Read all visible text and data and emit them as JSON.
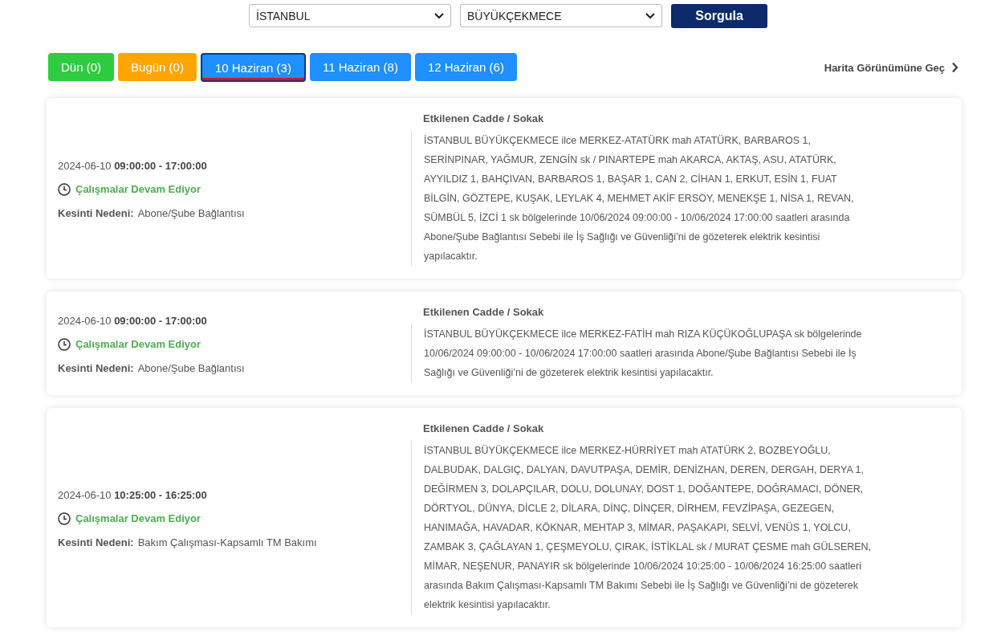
{
  "filters": {
    "city": "İSTANBUL",
    "district": "BÜYÜKÇEKMECE",
    "submit": "Sorgula"
  },
  "tabs": [
    {
      "label": "Dün (0)",
      "color": "#2ecc40",
      "selected": false
    },
    {
      "label": "Bugün (0)",
      "color": "#ffa500",
      "selected": false
    },
    {
      "label": "10 Haziran (3)",
      "color": "#1e90ff",
      "selected": true
    },
    {
      "label": "11 Haziran (8)",
      "color": "#1e90ff",
      "selected": false
    },
    {
      "label": "12 Haziran (6)",
      "color": "#1e90ff",
      "selected": false
    }
  ],
  "map_link": "Harita Görünümüne Geç",
  "outages": [
    {
      "datetime": "2024-06-10 **09:00:00 - 17:00:00**",
      "status": "Çalışmalar Devam Ediyor",
      "reason_label": "Kesinti Nedeni:",
      "reason": "Abone/Şube Bağlantısı",
      "streets_title": "Etkilenen Cadde / Sokak",
      "description": "İSTANBUL BÜYÜKÇEKMECE ilce MERKEZ-ATATÜRK mah ATATÜRK, BARBAROS 1, SERİNPINAR, YAĞMUR, ZENGİN sk / PINARTEPE mah AKARCA, AKTAŞ, ASU, ATATÜRK, AYYILDIZ 1, BAHÇIVAN, BARBAROS 1, BAŞAR 1, CAN 2, CİHAN 1, ERKUT, ESİN 1, FUAT BİLGİN, GÖZTEPE, KUŞAK, LEYLAK 4, MEHMET AKİF ERSOY, MENEKŞE 1, NİSA 1, REVAN, SÜMBÜL 5, İZCİ 1 sk bölgelerinde 10/06/2024 09:00:00 - 10/06/2024 17:00:00 saatleri arasında Abone/Şube Bağlantısı Sebebi ile İş Sağlığı ve Güvenliği’ni de gözeterek elektrik kesintisi yapılacaktır."
    },
    {
      "datetime": "2024-06-10 **09:00:00 - 17:00:00**",
      "status": "Çalışmalar Devam Ediyor",
      "reason_label": "Kesinti Nedeni:",
      "reason": "Abone/Şube Bağlantısı",
      "streets_title": "Etkilenen Cadde / Sokak",
      "description": "İSTANBUL BÜYÜKÇEKMECE ilce MERKEZ-FATİH mah RIZA KÜÇÜKOĞLUPAŞA sk bölgelerinde 10/06/2024 09:00:00 - 10/06/2024 17:00:00 saatleri arasında Abone/Şube Bağlantısı Sebebi ile İş Sağlığı ve Güvenliği’ni de gözeterek elektrik kesintisi yapılacaktır."
    },
    {
      "datetime": "2024-06-10 **10:25:00 - 16:25:00**",
      "status": "Çalışmalar Devam Ediyor",
      "reason_label": "Kesinti Nedeni:",
      "reason": "Bakım Çalışması-Kapsamlı TM Bakımı",
      "streets_title": "Etkilenen Cadde / Sokak",
      "description": "İSTANBUL BÜYÜKÇEKMECE ilce MERKEZ-HÜRRİYET mah ATATÜRK 2, BOZBEYOĞLU, DALBUDAK, DALGIÇ, DALYAN, DAVUTPAŞA, DEMİR, DENİZHAN, DEREN, DERGAH, DERYA 1, DEĞİRMEN 3, DOLAPÇILAR, DOLU, DOLUNAY, DOST 1, DOĞANTEPE, DOĞRAMACI, DÖNER, DÖRTYOL, DÜNYA, DİCLE 2, DİLARA, DİNÇ, DİNÇER, DİRHEM, FEVZİPAŞA, GEZEGEN, HANIMAĞA, HAVADAR, KÖKNAR, MEHTAP 3, MİMAR, PAŞAKAPI, SELVİ, VENÜS 1, YOLCU, ZAMBAK 3, ÇAĞLAYAN 1, ÇEŞMEYOLU, ÇIRAK, İSTİKLAL sk / MURAT ÇESME mah GÜLSEREN, MİMAR, NEŞENUR, PANAYIR sk bölgelerinde 10/06/2024 10:25:00 - 10/06/2024 16:25:00 saatleri arasında Bakım Çalışması-Kapsamlı TM Bakımı Sebebi ile İş Sağlığı ve Güvenliği’ni de gözeterek elektrik kesintisi yapılacaktır."
    }
  ]
}
